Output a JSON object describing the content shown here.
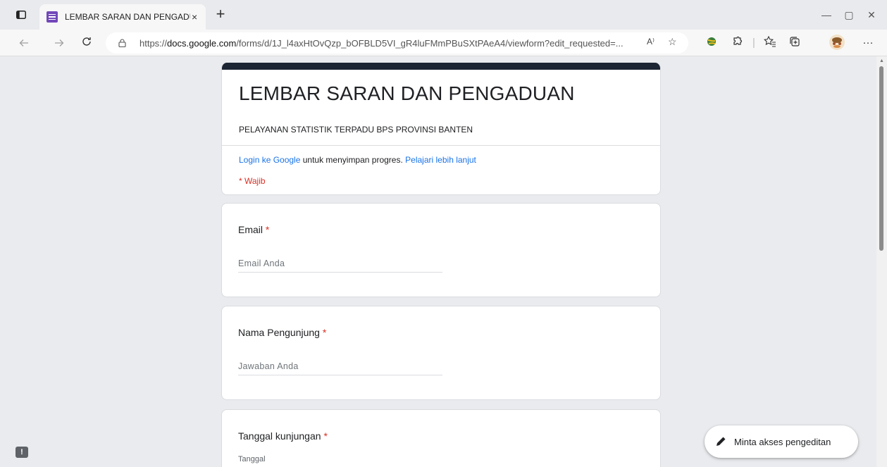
{
  "browser": {
    "tab_title": "LEMBAR SARAN DAN PENGADUAN",
    "tab_close": "×",
    "new_tab": "+",
    "url_prefix": "https://",
    "url_host": "docs.google.com",
    "url_rest": "/forms/d/1J_l4axHtOvQzp_bOFBLD5VI_gR4luFMmPBuSXtPAeA4/viewform?edit_requested=...",
    "read_aloud": "A⁾",
    "window_controls": [
      "—",
      "▢",
      "✕"
    ],
    "more": "···"
  },
  "form": {
    "title": "LEMBAR SARAN DAN PENGADUAN",
    "description": "PELAYANAN STATISTIK TERPADU BPS PROVINSI BANTEN",
    "login_link": "Login ke Google",
    "login_text": " untuk menyimpan progres. ",
    "learn_more": "Pelajari lebih lanjut",
    "required_note": "* Wajib",
    "star": "*",
    "questions": [
      {
        "label": "Email",
        "placeholder": "Email Anda"
      },
      {
        "label": "Nama Pengunjung",
        "placeholder": "Jawaban Anda"
      },
      {
        "label": "Tanggal kunjungan",
        "sublabel": "Tanggal"
      }
    ]
  },
  "edit_request_button": "Minta akses pengeditan",
  "feedback_icon": "!",
  "colors": {
    "header_stripe": "#1c2533",
    "link": "#1a73e8",
    "required": "#d93025",
    "favicon": "#7248b9"
  },
  "icons": [
    "tab-actions-icon",
    "forms-favicon",
    "back-arrow-icon",
    "forward-arrow-icon",
    "refresh-icon",
    "lock-icon",
    "read-aloud-icon",
    "add-favorite-icon",
    "extension-icon",
    "extensions-puzzle-icon",
    "favorites-icon",
    "collections-icon",
    "profile-avatar",
    "more-icon",
    "pencil-icon",
    "feedback-icon"
  ]
}
